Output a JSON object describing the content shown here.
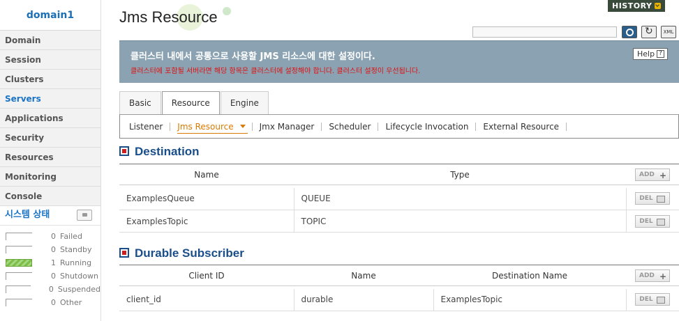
{
  "sidebar": {
    "domain": "domain1",
    "nav": [
      {
        "label": "Domain",
        "active": false
      },
      {
        "label": "Session",
        "active": false
      },
      {
        "label": "Clusters",
        "active": false
      },
      {
        "label": "Servers",
        "active": true
      },
      {
        "label": "Applications",
        "active": false
      },
      {
        "label": "Security",
        "active": false
      },
      {
        "label": "Resources",
        "active": false
      },
      {
        "label": "Monitoring",
        "active": false
      },
      {
        "label": "Console",
        "active": false
      }
    ],
    "system_status_label": "시스템 상태",
    "statuses": [
      {
        "count": "0",
        "label": "Failed"
      },
      {
        "count": "0",
        "label": "Standby"
      },
      {
        "count": "1",
        "label": "Running"
      },
      {
        "count": "0",
        "label": "Shutdown"
      },
      {
        "count": "0",
        "label": "Suspended"
      },
      {
        "count": "0",
        "label": "Other"
      }
    ]
  },
  "header": {
    "title": "Jms Resource",
    "history_label": "HISTORY",
    "xml_label": "XML"
  },
  "banner": {
    "line1": "클러스터 내에서 공통으로 사용할 JMS 리소스에 대한 설정이다.",
    "line2": "클러스터에 포함될 서버라면 해당 항목은 클러스터에 설정해야 합니다. 클러스터 설정이 우선됩니다.",
    "help_label": "Help",
    "help_glyph": "?"
  },
  "tabs": [
    {
      "label": "Basic",
      "active": false
    },
    {
      "label": "Resource",
      "active": true
    },
    {
      "label": "Engine",
      "active": false
    }
  ],
  "subnav": [
    {
      "label": "Listener",
      "active": false
    },
    {
      "label": "Jms Resource",
      "active": true
    },
    {
      "label": "Jmx Manager",
      "active": false
    },
    {
      "label": "Scheduler",
      "active": false
    },
    {
      "label": "Lifecycle Invocation",
      "active": false
    },
    {
      "label": "External Resource",
      "active": false
    }
  ],
  "destination": {
    "title": "Destination",
    "columns": [
      "Name",
      "Type"
    ],
    "add_label": "ADD",
    "del_label": "DEL",
    "rows": [
      {
        "name": "ExamplesQueue",
        "type": "QUEUE"
      },
      {
        "name": "ExamplesTopic",
        "type": "TOPIC"
      }
    ]
  },
  "durable": {
    "title": "Durable Subscriber",
    "columns": [
      "Client ID",
      "Name",
      "Destination Name"
    ],
    "add_label": "ADD",
    "del_label": "DEL",
    "rows": [
      {
        "client_id": "client_id",
        "name": "durable",
        "destination": "ExamplesTopic"
      }
    ]
  }
}
